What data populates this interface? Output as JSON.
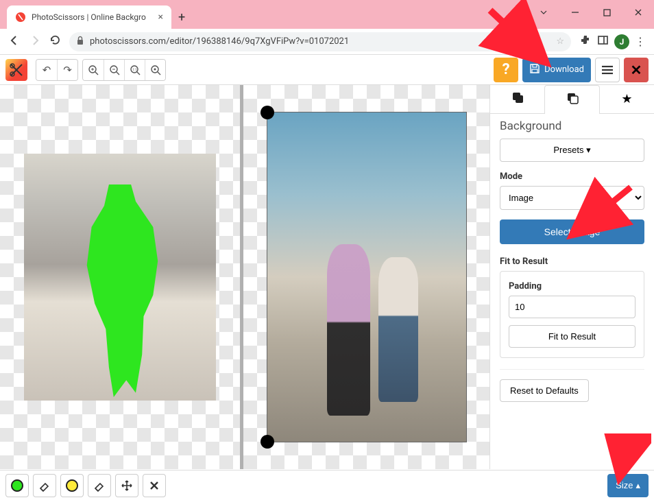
{
  "browser": {
    "tab_title": "PhotoScissors | Online Backgro",
    "url": "photoscissors.com/editor/196388146/9q7XgVFiPw?v=01072021",
    "profile_initial": "J"
  },
  "toolbar": {
    "download_label": "Download"
  },
  "panel": {
    "heading": "Background",
    "presets_label": "Presets ",
    "mode_label": "Mode",
    "mode_value": "Image",
    "select_image_label": "Select Image",
    "fit_label": "Fit to Result",
    "padding_label": "Padding",
    "padding_value": "10",
    "fit_button_label": "Fit to Result",
    "reset_label": "Reset to Defaults"
  },
  "bottom": {
    "size_label": "Size "
  }
}
